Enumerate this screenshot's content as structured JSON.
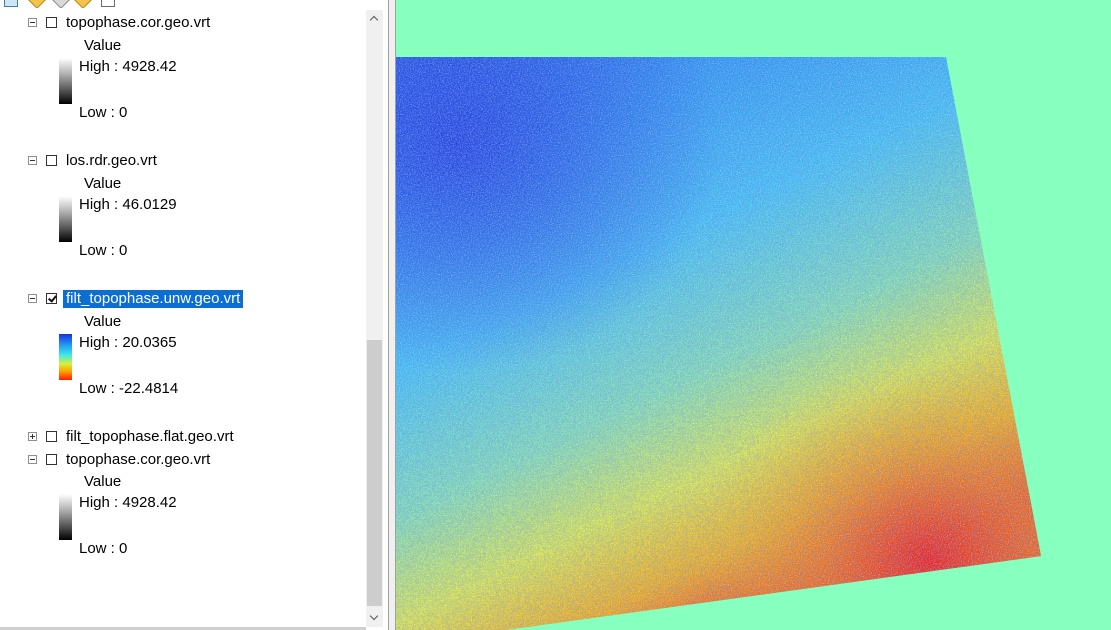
{
  "toc": {
    "layers": [
      {
        "name": "topophase.cor.geo.vrt",
        "expanded": true,
        "checked": false,
        "selected": false,
        "legend": {
          "title": "Value",
          "high": "High : 4928.42",
          "low": "Low : 0",
          "ramp": "gray"
        }
      },
      {
        "name": "los.rdr.geo.vrt",
        "expanded": true,
        "checked": false,
        "selected": false,
        "legend": {
          "title": "Value",
          "high": "High : 46.0129",
          "low": "Low : 0",
          "ramp": "gray"
        }
      },
      {
        "name": "filt_topophase.unw.geo.vrt",
        "expanded": true,
        "checked": true,
        "selected": true,
        "legend": {
          "title": "Value",
          "high": "High : 20.0365",
          "low": "Low : -22.4814",
          "ramp": "rainbow"
        }
      },
      {
        "name": "filt_topophase.flat.geo.vrt",
        "expanded": false,
        "checked": false,
        "selected": false
      },
      {
        "name": "topophase.cor.geo.vrt",
        "expanded": true,
        "checked": false,
        "selected": false,
        "legend": {
          "title": "Value",
          "high": "High : 4928.42",
          "low": "Low : 0",
          "ramp": "gray"
        }
      }
    ],
    "toolbar_icons": [
      "list-by-drawing-order-icon",
      "list-by-source-icon",
      "list-by-visibility-icon",
      "list-by-selection-icon",
      "options-icon"
    ]
  },
  "map": {
    "background_color": "#87ffbf",
    "layer_displayed": "filt_topophase.unw.geo.vrt",
    "colors": {
      "low": "#ff1a00",
      "mid": "#d7f03a",
      "high": "#1d2fe0"
    }
  }
}
